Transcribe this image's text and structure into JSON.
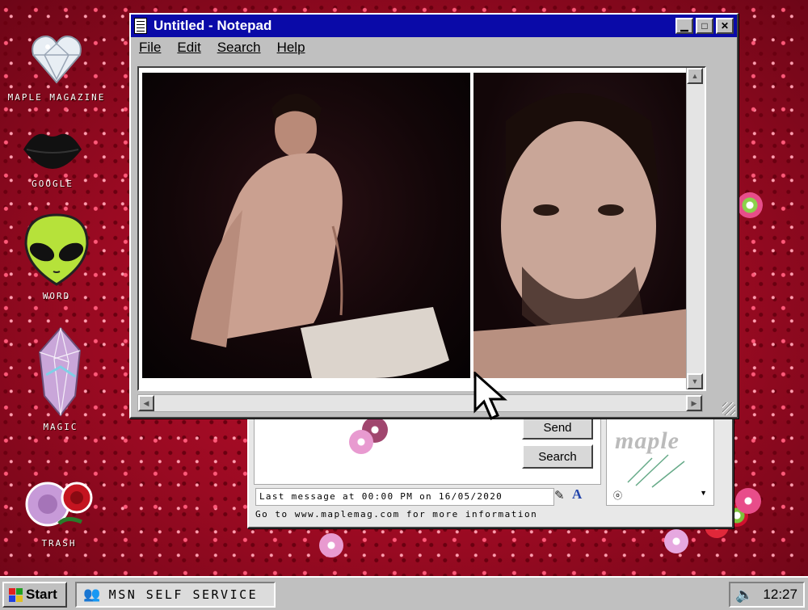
{
  "desktop": {
    "icons": [
      {
        "label": "MAPLE MAGAZINE",
        "icon": "heart-diamond-icon"
      },
      {
        "label": "GOOGLE",
        "icon": "lips-icon"
      },
      {
        "label": "WORD",
        "icon": "alien-icon"
      },
      {
        "label": "MAGIC",
        "icon": "crystal-icon"
      },
      {
        "label": "TRASH",
        "icon": "roses-icon"
      }
    ]
  },
  "notepad": {
    "title": "Untitled - Notepad",
    "menu": [
      "File",
      "Edit",
      "Search",
      "Help"
    ]
  },
  "msn_window": {
    "send_label": "Send",
    "search_label": "Search",
    "last_message": "Last message at 00:00 PM on 16/05/2020",
    "footer": "Go to www.maplemag.com for more information",
    "logo_text": "maple"
  },
  "taskbar": {
    "start_label": "Start",
    "task_label": "MSN SELF SERVICE",
    "clock": "12:27"
  },
  "colors": {
    "titlebar": "#0a0aa8",
    "desktop_glitter": "#c0102e",
    "window_gray": "#c0c0c0"
  }
}
